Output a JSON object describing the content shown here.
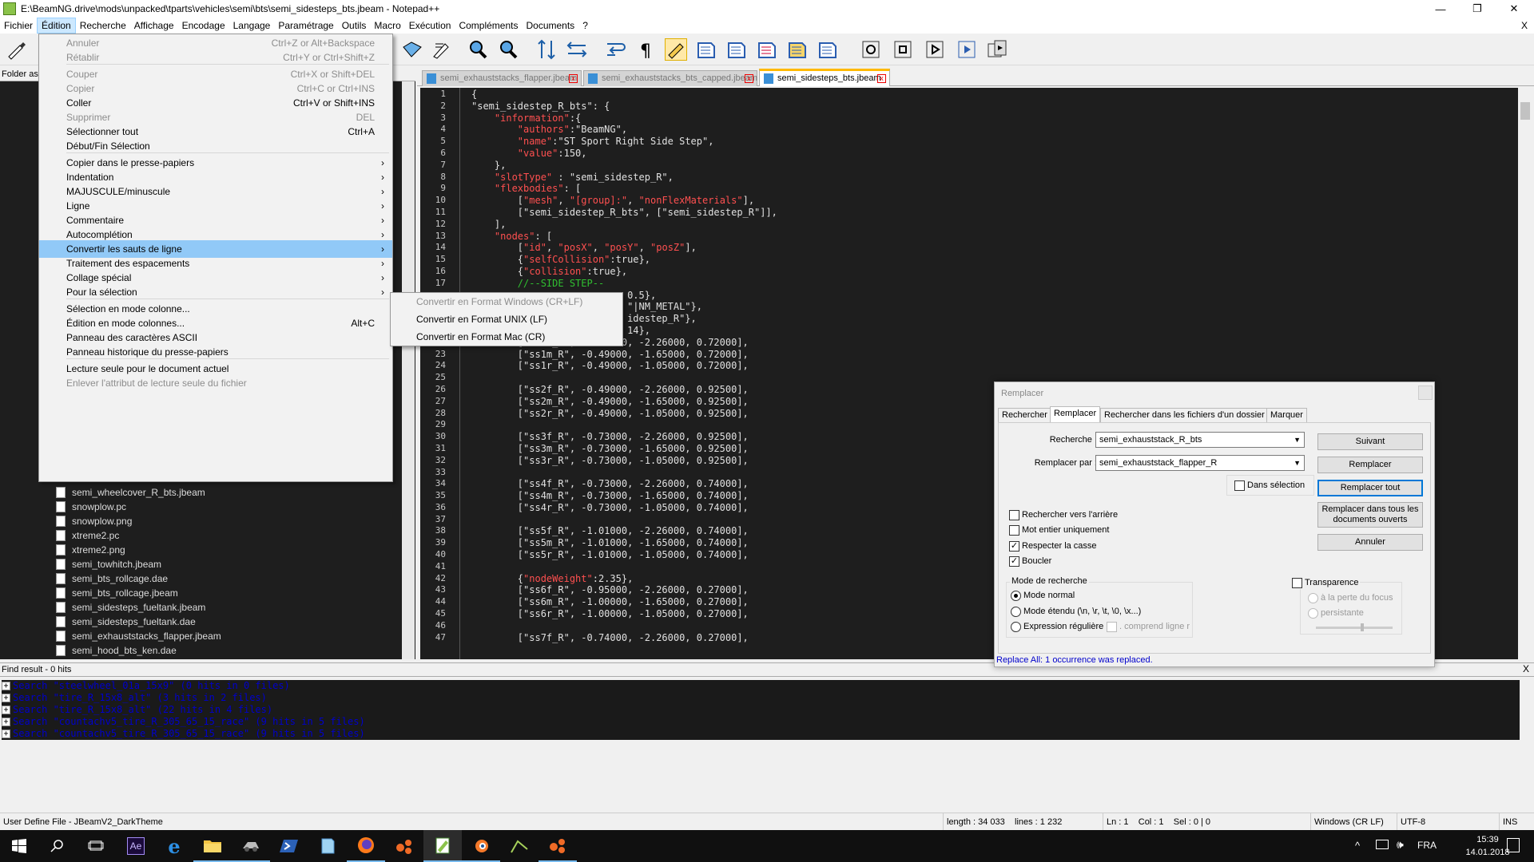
{
  "window": {
    "title": "E:\\BeamNG.drive\\mods\\unpacked\\tparts\\vehicles\\semi\\bts\\semi_sidesteps_bts.jbeam - Notepad++",
    "controls": [
      "—",
      "❐",
      "✕"
    ],
    "close_doc": "X"
  },
  "menubar": [
    "Fichier",
    "Édition",
    "Recherche",
    "Affichage",
    "Encodage",
    "Langage",
    "Paramétrage",
    "Outils",
    "Macro",
    "Exécution",
    "Compléments",
    "Documents",
    "?"
  ],
  "left_panel": {
    "folder_label": "Folder as",
    "files": [
      "semi_wheelcover_R_bts.jbeam",
      "snowplow.pc",
      "snowplow.png",
      "xtreme2.pc",
      "xtreme2.png",
      "semi_towhitch.jbeam",
      "semi_bts_rollcage.dae",
      "semi_bts_rollcage.jbeam",
      "semi_sidesteps_fueltank.jbeam",
      "semi_sidesteps_fueltank.dae",
      "semi_exhauststacks_flapper.jbeam",
      "semi_hood_bts_ken.dae"
    ]
  },
  "tabs": [
    {
      "label": "semi_exhauststacks_flapper.jbeam",
      "active": false
    },
    {
      "label": "semi_exhauststacks_bts_capped.jbeam",
      "active": false
    },
    {
      "label": "semi_sidesteps_bts.jbeam",
      "active": true
    }
  ],
  "edit_menu": {
    "items": [
      {
        "label": "Annuler",
        "shortcut": "Ctrl+Z or Alt+Backspace",
        "disabled": true
      },
      {
        "label": "Rétablir",
        "shortcut": "Ctrl+Y or Ctrl+Shift+Z",
        "disabled": true
      },
      {
        "label": "Couper",
        "shortcut": "Ctrl+X or Shift+DEL",
        "disabled": true
      },
      {
        "label": "Copier",
        "shortcut": "Ctrl+C or Ctrl+INS",
        "disabled": true
      },
      {
        "label": "Coller",
        "shortcut": "Ctrl+V or Shift+INS",
        "disabled": false
      },
      {
        "label": "Supprimer",
        "shortcut": "DEL",
        "disabled": true
      },
      {
        "label": "Sélectionner tout",
        "shortcut": "Ctrl+A",
        "disabled": false
      },
      {
        "label": "Début/Fin Sélection",
        "shortcut": "",
        "disabled": false
      },
      {
        "label": "Copier dans le presse-papiers",
        "submenu": true
      },
      {
        "label": "Indentation",
        "submenu": true
      },
      {
        "label": "MAJUSCULE/minuscule",
        "submenu": true
      },
      {
        "label": "Ligne",
        "submenu": true
      },
      {
        "label": "Commentaire",
        "submenu": true
      },
      {
        "label": "Autocomplétion",
        "submenu": true
      },
      {
        "label": "Convertir les sauts de ligne",
        "submenu": true,
        "highlighted": true
      },
      {
        "label": "Traitement des espacements",
        "submenu": true
      },
      {
        "label": "Collage spécial",
        "submenu": true
      },
      {
        "label": "Pour la sélection",
        "submenu": true
      },
      {
        "label": "Sélection en mode colonne...",
        "shortcut": ""
      },
      {
        "label": "Édition en mode colonnes...",
        "shortcut": "Alt+C"
      },
      {
        "label": "Panneau des caractères ASCII",
        "shortcut": ""
      },
      {
        "label": "Panneau historique du presse-papiers",
        "shortcut": ""
      },
      {
        "label": "Lecture seule pour le document actuel",
        "shortcut": ""
      },
      {
        "label": "Enlever l'attribut de lecture seule du fichier",
        "shortcut": "",
        "disabled": true
      }
    ],
    "arrow": "›"
  },
  "submenu": [
    {
      "label": "Convertir en Format Windows (CR+LF)",
      "disabled": true
    },
    {
      "label": "Convertir en Format UNIX (LF)",
      "disabled": false
    },
    {
      "label": "Convertir en Format Mac (CR)",
      "disabled": false
    }
  ],
  "editor": {
    "line_numbers": [
      "1",
      "2",
      "3",
      "4",
      "5",
      "6",
      "7",
      "8",
      "9",
      "10",
      "11",
      "12",
      "13",
      "14",
      "15",
      "16",
      "17",
      "",
      "",
      "",
      "",
      "22",
      "23",
      "24",
      "25",
      "26",
      "27",
      "28",
      "29",
      "30",
      "31",
      "32",
      "33",
      "34",
      "35",
      "36",
      "37",
      "38",
      "39",
      "40",
      "41",
      "42",
      "43",
      "44",
      "45",
      "46",
      "47"
    ]
  },
  "dialog": {
    "title": "Remplacer",
    "tabs": [
      "Rechercher",
      "Remplacer",
      "Rechercher dans les fichiers d'un dossier",
      "Marquer"
    ],
    "search_label": "Recherche :",
    "search_value": "semi_exhauststack_R_bts",
    "replace_label": "Remplacer par :",
    "replace_value": "semi_exhauststack_flapper_R",
    "in_selection": "Dans sélection",
    "buttons": {
      "next": "Suivant",
      "replace": "Remplacer",
      "replace_all": "Remplacer tout",
      "replace_all_open": "Remplacer dans tous les documents ouverts",
      "cancel": "Annuler"
    },
    "options": [
      {
        "label": "Rechercher vers l'arrière",
        "checked": false
      },
      {
        "label": "Mot entier uniquement",
        "checked": false
      },
      {
        "label": "Respecter la casse",
        "checked": true
      },
      {
        "label": "Boucler",
        "checked": true
      }
    ],
    "mode_title": "Mode de recherche",
    "modes": [
      "Mode normal",
      "Mode étendu (\\n, \\r, \\t, \\0, \\x...)",
      "Expression régulière"
    ],
    "dot_newline": ". comprend ligne r",
    "transparency": "Transparence",
    "transp_opts": [
      "à la perte du focus",
      "persistante"
    ],
    "status": "Replace All: 1 occurrence was replaced."
  },
  "find_results": {
    "header": "Find result - 0 hits",
    "lines": [
      "Search \"steelwheel_01a_15x9\" (0 hits in 0 files)",
      "Search \"tire_R_15x8_alt\" (3 hits in 2 files)",
      "Search \"tire_R_15x8_alt\" (22 hits in 4 files)",
      "Search \"countachv5_tire_R_305_65_15_race\" (9 hits in 5 files)",
      "Search \"countachv5_tire_R_305_65_15_race\" (9 hits in 5 files)"
    ]
  },
  "status": {
    "lang": "User Define File - JBeamV2_DarkTheme",
    "length": "length : 34 033",
    "lines": "lines : 1 232",
    "pos": "Ln : 1    Col : 1    Sel : 0 | 0",
    "eol": "Windows (CR LF)",
    "enc": "UTF-8",
    "ins": "INS"
  },
  "taskbar": {
    "lang": "FRA",
    "time": "15:39",
    "date": "14.01.2018",
    "ae_label": "Ae"
  }
}
